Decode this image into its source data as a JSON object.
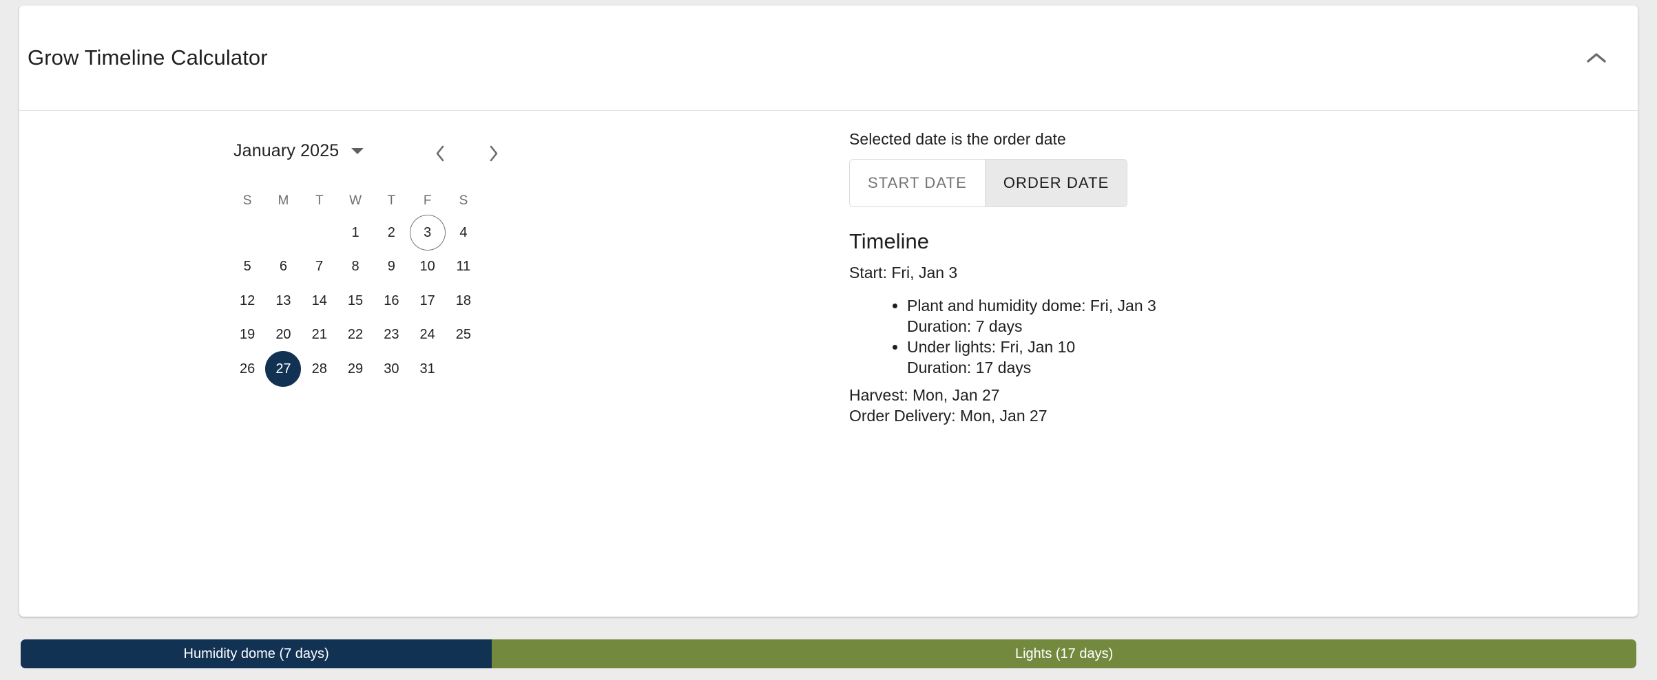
{
  "accent": {
    "navy": "#123253",
    "olive": "#738a3e",
    "page_bg": "#ececec",
    "card_bg": "#ffffff",
    "selected_text": "#ffffff",
    "muted_text": "#6d6d6d"
  },
  "header": {
    "title": "Grow Timeline Calculator",
    "collapse_icon": "chevron-up-icon"
  },
  "calendar": {
    "month_label": "January 2025",
    "dropdown_icon": "caret-down-icon",
    "prev_icon": "chevron-left-icon",
    "next_icon": "chevron-right-icon",
    "weekdays": [
      "S",
      "M",
      "T",
      "W",
      "T",
      "F",
      "S"
    ],
    "weeks": [
      [
        "",
        "",
        "",
        "1",
        "2",
        "3",
        "4"
      ],
      [
        "5",
        "6",
        "7",
        "8",
        "9",
        "10",
        "11"
      ],
      [
        "12",
        "13",
        "14",
        "15",
        "16",
        "17",
        "18"
      ],
      [
        "19",
        "20",
        "21",
        "22",
        "23",
        "24",
        "25"
      ],
      [
        "26",
        "27",
        "28",
        "29",
        "30",
        "31",
        ""
      ]
    ],
    "outlined_day": "3",
    "selected_day": "27"
  },
  "panel": {
    "caption": "Selected date is the order date",
    "mode_toggle": {
      "options": [
        "START DATE",
        "ORDER DATE"
      ],
      "selected": "ORDER DATE"
    },
    "timeline_heading": "Timeline",
    "start_line": "Start: Fri, Jan 3",
    "stages": [
      {
        "title": "Plant and humidity dome: Fri, Jan 3",
        "duration": "Duration: 7 days"
      },
      {
        "title": "Under lights: Fri, Jan 10",
        "duration": "Duration: 17 days"
      }
    ],
    "harvest_line": "Harvest: Mon, Jan 27",
    "delivery_line": "Order Delivery: Mon, Jan 27"
  },
  "phase_bar": {
    "segments": [
      {
        "label": "Humidity dome (7 days)",
        "days": 7,
        "color": "#123253"
      },
      {
        "label": "Lights (17 days)",
        "days": 17,
        "color": "#738a3e"
      }
    ],
    "total_days": 24
  }
}
